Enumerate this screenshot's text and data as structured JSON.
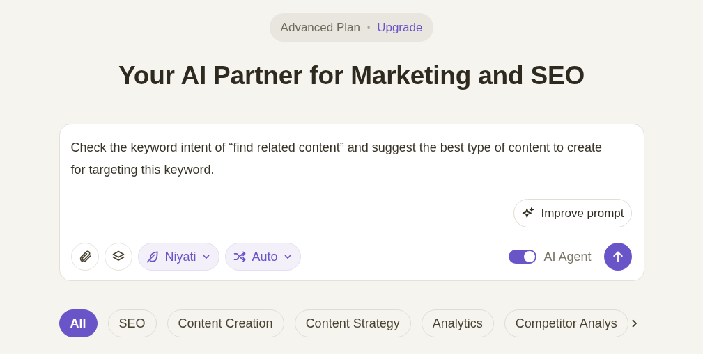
{
  "plan": {
    "name": "Advanced Plan",
    "separator": "•",
    "link": "Upgrade"
  },
  "headline": "Your AI Partner for Marketing and SEO",
  "prompt": {
    "value": "Check the keyword intent of “find related content” and suggest the best type of content to create for targeting this keyword.",
    "improve_button": "Improve prompt",
    "tools": [
      {
        "kind": "attach"
      },
      {
        "kind": "layers"
      }
    ],
    "dropdowns": [
      {
        "kind": "persona",
        "label": "Niyati"
      },
      {
        "kind": "mode",
        "label": "Auto"
      }
    ],
    "agent_toggle": {
      "label": "AI Agent",
      "on": true
    }
  },
  "categories": [
    {
      "label": "All",
      "selected": true
    },
    {
      "label": "SEO",
      "selected": false
    },
    {
      "label": "Content Creation",
      "selected": false
    },
    {
      "label": "Content Strategy",
      "selected": false
    },
    {
      "label": "Analytics",
      "selected": false
    },
    {
      "label": "Competitor Analys",
      "selected": false
    }
  ]
}
